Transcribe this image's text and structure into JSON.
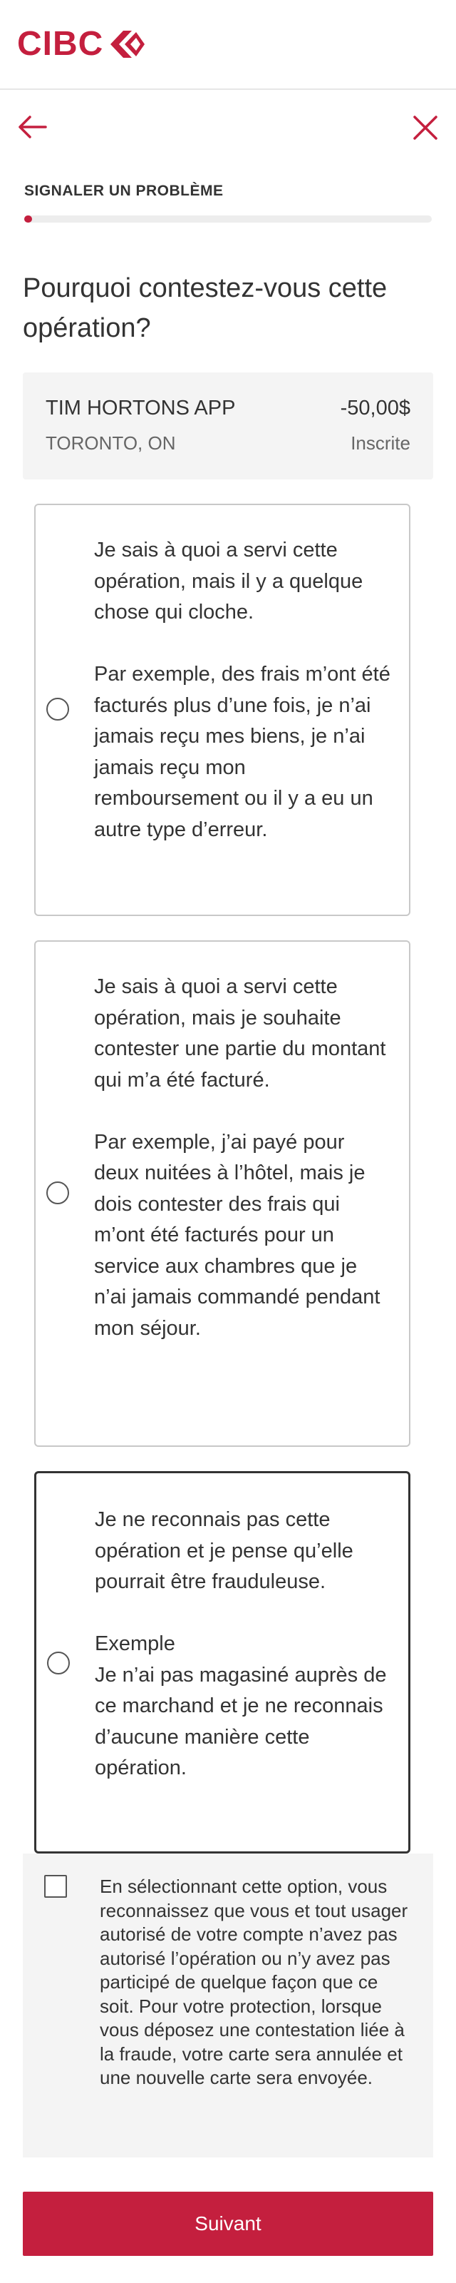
{
  "brand": {
    "logo_text": "CIBC",
    "accent_color": "#c41f3e"
  },
  "icons": {
    "back": "arrow-left-icon",
    "close": "close-icon",
    "logo_mark": "cibc-diamond-logo-icon"
  },
  "step": {
    "title": "SIGNALER UN PROBLÈME",
    "progress_fraction": 0.02
  },
  "question": "Pourquoi contestez-vous cette opération?",
  "transaction": {
    "merchant": "TIM HORTONS APP",
    "amount": "-50,00$",
    "location": "TORONTO, ON",
    "status": "Inscrite"
  },
  "options": [
    {
      "line1": "Je sais à quoi a servi cette opération, mais il y a quelque chose qui cloche.",
      "line2": "Par exemple, des frais m’ont été facturés plus d’une fois, je n’ai jamais reçu mes biens, je n’ai jamais reçu mon remboursement ou il y a eu un autre type d’erreur.",
      "selected": false
    },
    {
      "line1": "Je sais à quoi a servi cette opération, mais je souhaite contester une partie du montant qui m’a été facturé.",
      "line2": "Par exemple, j’ai payé pour deux nuitées à l’hôtel, mais je dois contester des frais qui m’ont été facturés pour un service aux chambres que je n’ai jamais commandé pendant mon séjour.",
      "selected": false
    },
    {
      "line1": "Je ne reconnais pas cette opération et je pense qu’elle pourrait être frauduleuse.",
      "line2_title": "Exemple",
      "line2": "Je n’ai pas magasiné auprès de ce marchand et je ne reconnais d’aucune manière cette opération.",
      "selected": true
    }
  ],
  "consent": {
    "text": "En sélectionnant cette option, vous reconnaissez que vous et tout usager autorisé de votre compte n’avez pas autorisé l’opération ou n’y avez pas participé de quelque façon que ce soit. Pour votre protection, lorsque vous déposez une contestation liée à la fraude, votre carte sera annulée et une nouvelle carte sera envoyée.",
    "checked": false
  },
  "next_button": "Suivant"
}
